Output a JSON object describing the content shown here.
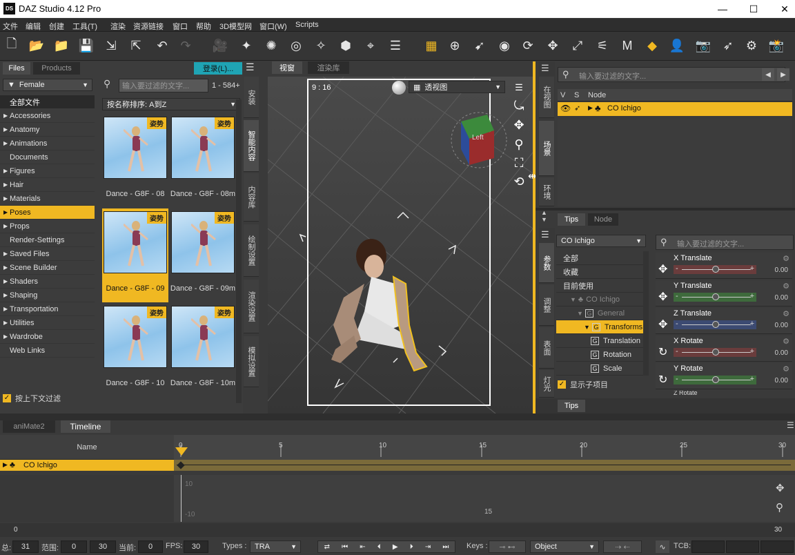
{
  "app": {
    "title": "DAZ Studio 4.12 Pro",
    "logo": "DS"
  },
  "menu": [
    "文件",
    "编辑",
    "创建",
    "工具(T)",
    "渲染",
    "资源链接",
    "窗口",
    "帮助",
    "3D模型网",
    "窗口(W)",
    "Scripts"
  ],
  "left_panel": {
    "tabs": [
      "Files",
      "Products"
    ],
    "login_label": "登录(L)...",
    "category_select": "Female",
    "all_files": "全部文件",
    "categories": [
      {
        "label": "Accessories",
        "arrow": "▶"
      },
      {
        "label": "Anatomy",
        "arrow": "▶"
      },
      {
        "label": "Animations",
        "arrow": "▶"
      },
      {
        "label": "Documents",
        "arrow": ""
      },
      {
        "label": "Figures",
        "arrow": "▶"
      },
      {
        "label": "Hair",
        "arrow": "▶"
      },
      {
        "label": "Materials",
        "arrow": "▶"
      },
      {
        "label": "Poses",
        "arrow": "▶"
      },
      {
        "label": "Props",
        "arrow": "▶"
      },
      {
        "label": "Render-Settings",
        "arrow": ""
      },
      {
        "label": "Saved Files",
        "arrow": "▶"
      },
      {
        "label": "Scene Builder",
        "arrow": "▶"
      },
      {
        "label": "Shaders",
        "arrow": "▶"
      },
      {
        "label": "Shaping",
        "arrow": "▶"
      },
      {
        "label": "Transportation",
        "arrow": "▶"
      },
      {
        "label": "Utilities",
        "arrow": "▶"
      },
      {
        "label": "Wardrobe",
        "arrow": "▶"
      },
      {
        "label": "Web Links",
        "arrow": ""
      }
    ],
    "context_filter": "按上下文过滤",
    "search_placeholder": "输入要过滤的文字...",
    "range": "1 - 584+",
    "sort": "按名称排序: A到Z",
    "badge": "姿势",
    "thumbnails": [
      "Dance - G8F - 08",
      "Dance - G8F - 08m",
      "Dance - G8F - 09",
      "Dance - G8F - 09m",
      "Dance - G8F - 10",
      "Dance - G8F - 10m"
    ],
    "side_tabs": [
      "安装",
      "智能内容",
      "内容库",
      "绘制设置",
      "渲染设置",
      "模拟设置"
    ]
  },
  "viewport": {
    "tabs": [
      "视窗",
      "渲染库"
    ],
    "ratio": "9 : 16",
    "camera": "透视图",
    "cube_label": "Left"
  },
  "scene": {
    "side_tabs": [
      "在视图",
      "场景",
      "环境"
    ],
    "search_placeholder": "输入要过滤的文字...",
    "columns": [
      "V",
      "S",
      "Node"
    ],
    "node": "CO Ichigo",
    "tabs": [
      "Tips",
      "Node"
    ]
  },
  "params": {
    "side_tabs": [
      "参数",
      "调整",
      "表面",
      "灯光"
    ],
    "select": "CO Ichigo",
    "search_placeholder": "输入要过滤的文字...",
    "tree": [
      {
        "label": "全部",
        "indent": 0,
        "sel": false,
        "dim": false,
        "kind": "plain"
      },
      {
        "label": "收藏",
        "indent": 0,
        "sel": false,
        "dim": false,
        "kind": "plain"
      },
      {
        "label": "目前使用",
        "indent": 0,
        "sel": false,
        "dim": false,
        "kind": "plain"
      },
      {
        "label": "CO Ichigo",
        "indent": 1,
        "sel": false,
        "dim": true,
        "kind": "figure"
      },
      {
        "label": "General",
        "indent": 2,
        "sel": false,
        "dim": true,
        "kind": "group"
      },
      {
        "label": "Transforms",
        "indent": 3,
        "sel": true,
        "dim": false,
        "kind": "group"
      },
      {
        "label": "Translation",
        "indent": 4,
        "sel": false,
        "dim": false,
        "kind": "group"
      },
      {
        "label": "Rotation",
        "indent": 4,
        "sel": false,
        "dim": false,
        "kind": "group"
      },
      {
        "label": "Scale",
        "indent": 4,
        "sel": false,
        "dim": false,
        "kind": "group"
      }
    ],
    "show_sub": "显示子项目",
    "props": [
      {
        "name": "X Translate",
        "value": "0.00",
        "color": "#6a3c3c",
        "icon": "✥"
      },
      {
        "name": "Y Translate",
        "value": "0.00",
        "color": "#3e6a3c",
        "icon": "✥"
      },
      {
        "name": "Z Translate",
        "value": "0.00",
        "color": "#3c4a72",
        "icon": "✥"
      },
      {
        "name": "X Rotate",
        "value": "0.00",
        "color": "#6a3c3c",
        "icon": "↻"
      },
      {
        "name": "Y Rotate",
        "value": "0.00",
        "color": "#3e6a3c",
        "icon": "↻"
      }
    ],
    "next_prop": "Z Rotate",
    "bottom_tab": "Tips"
  },
  "timeline": {
    "tabs": [
      "aniMate2",
      "Timeline"
    ],
    "name_header": "Name",
    "track": "CO Ichigo",
    "ticks": [
      "0",
      "5",
      "10",
      "15",
      "20",
      "25",
      "30"
    ],
    "graph_labels": [
      "10",
      "-10",
      "15"
    ],
    "scroll_start": "0",
    "scroll_end": "30"
  },
  "status": {
    "total_label": "总:",
    "total": "31",
    "range_label": "范围:",
    "range_start": "0",
    "range_end": "30",
    "current_label": "当前:",
    "current": "0",
    "fps_label": "FPS:",
    "fps": "30",
    "types_label": "Types :",
    "types": "TRA",
    "keys_label": "Keys :",
    "object": "Object",
    "tcb_label": "TCB:"
  }
}
